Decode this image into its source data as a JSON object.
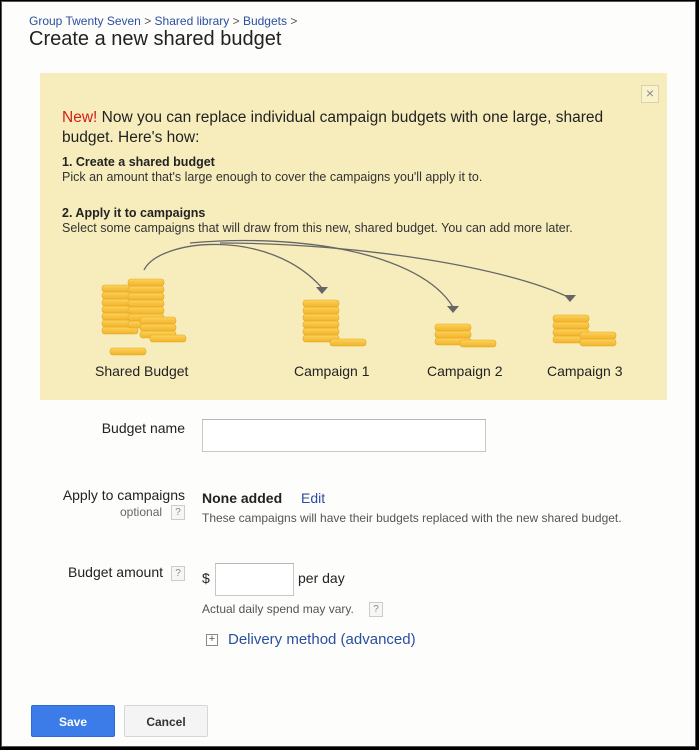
{
  "breadcrumb": {
    "items": [
      "Group Twenty Seven",
      "Shared library",
      "Budgets"
    ],
    "separator": ">"
  },
  "page_title": "Create a new shared budget",
  "banner": {
    "new_label": "New!",
    "lead_text": " Now you can replace individual campaign budgets with one large, shared budget. Here's how:",
    "close_label": "×",
    "steps": [
      {
        "title": "1. Create a shared budget",
        "description": "Pick an amount that's large enough to cover the campaigns you'll apply it to."
      },
      {
        "title": "2. Apply it to campaigns",
        "description": "Select some campaigns that will draw from this new, shared budget. You can add more later."
      }
    ],
    "illustration_labels": [
      "Shared Budget",
      "Campaign 1",
      "Campaign 2",
      "Campaign 3"
    ],
    "background_color": "#f7edbc"
  },
  "form": {
    "budget_name": {
      "label": "Budget name",
      "value": "",
      "placeholder": ""
    },
    "apply_to_campaigns": {
      "label": "Apply to campaigns",
      "sub_label": "optional",
      "help_label": "?",
      "value": "None added",
      "edit_link": "Edit",
      "hint": "These campaigns will have their budgets replaced with the new shared budget."
    },
    "budget_amount": {
      "label": "Budget amount",
      "help_label": "?",
      "currency_symbol": "$",
      "value": "",
      "unit": "per day",
      "hint": "Actual daily spend may vary.",
      "hint_help_label": "?"
    },
    "delivery_method": {
      "expand_icon": "+",
      "label": "Delivery method (advanced)"
    }
  },
  "buttons": {
    "save": "Save",
    "cancel": "Cancel"
  },
  "colors": {
    "primary_button": "#3c7ce8",
    "link": "#2a4ea0",
    "new_badge": "#d1201a"
  }
}
